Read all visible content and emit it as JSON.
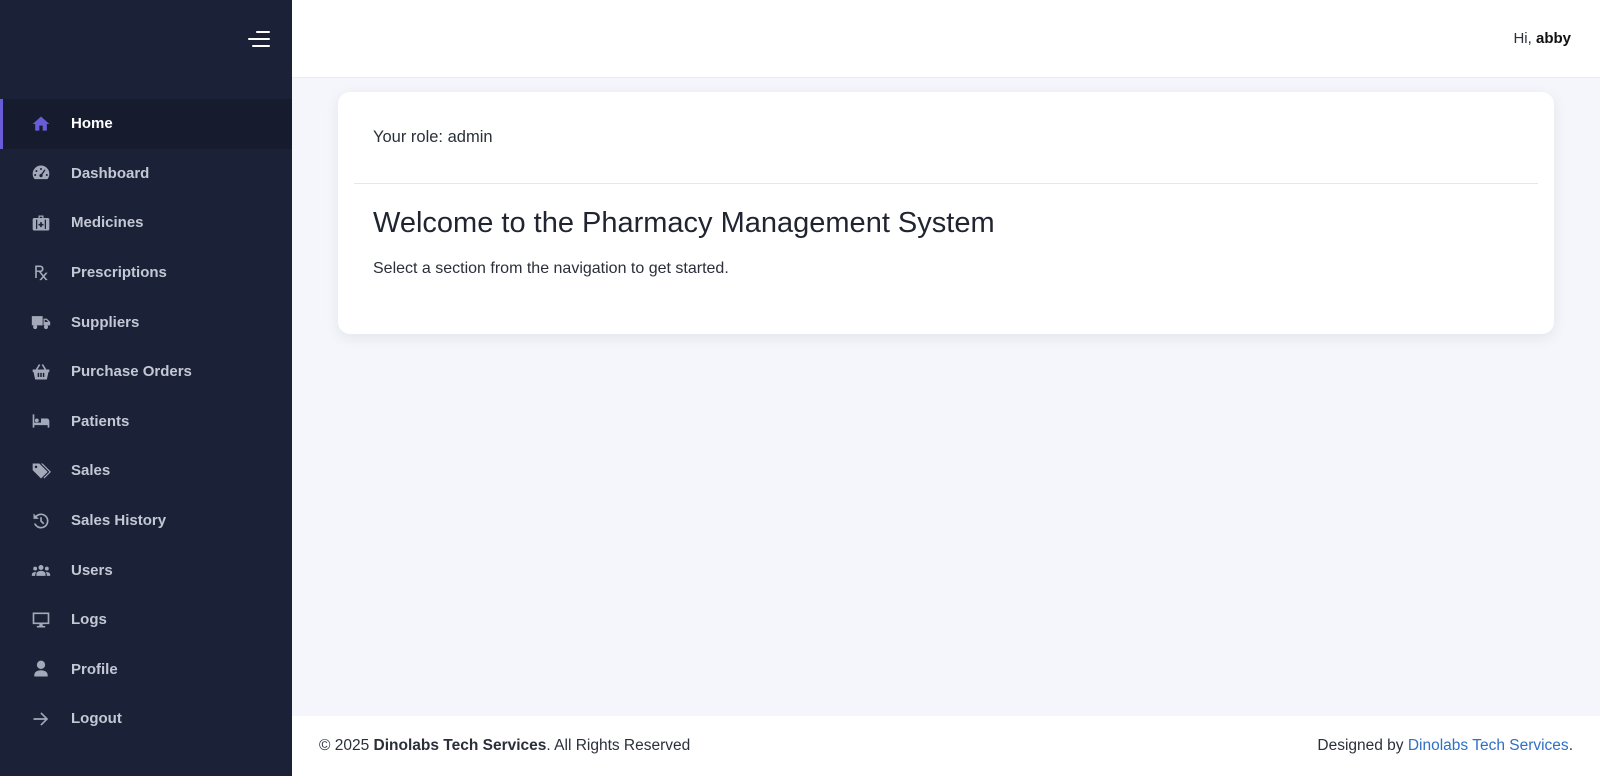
{
  "sidebar": {
    "toggle_icon": "menu-toggle-icon",
    "items": [
      {
        "label": "Home",
        "icon": "home-icon",
        "active": true
      },
      {
        "label": "Dashboard",
        "icon": "gauge-icon"
      },
      {
        "label": "Medicines",
        "icon": "medkit-icon"
      },
      {
        "label": "Prescriptions",
        "icon": "prescription-icon"
      },
      {
        "label": "Suppliers",
        "icon": "truck-icon"
      },
      {
        "label": "Purchase Orders",
        "icon": "basket-icon"
      },
      {
        "label": "Patients",
        "icon": "bed-icon"
      },
      {
        "label": "Sales",
        "icon": "tags-icon"
      },
      {
        "label": "Sales History",
        "icon": "history-icon"
      },
      {
        "label": "Users",
        "icon": "users-icon"
      },
      {
        "label": "Logs",
        "icon": "monitor-icon"
      },
      {
        "label": "Profile",
        "icon": "user-icon"
      },
      {
        "label": "Logout",
        "icon": "arrow-right-icon"
      }
    ],
    "accent_color": "#6a5cd6",
    "background_color": "#1b2238"
  },
  "header": {
    "greeting_prefix": "Hi,",
    "username": "abby"
  },
  "main": {
    "role_text": "Your role: admin",
    "title": "Welcome to the Pharmacy Management System",
    "subtitle": "Select a section from the navigation to get started."
  },
  "footer": {
    "copyright_prefix": "© 2025",
    "company": "Dinolabs Tech Services",
    "rights": ". All Rights Reserved",
    "designed_by": "Designed by",
    "designer_link": "Dinolabs Tech Services",
    "designer_suffix": ".",
    "link_color": "#2f6fc4"
  }
}
